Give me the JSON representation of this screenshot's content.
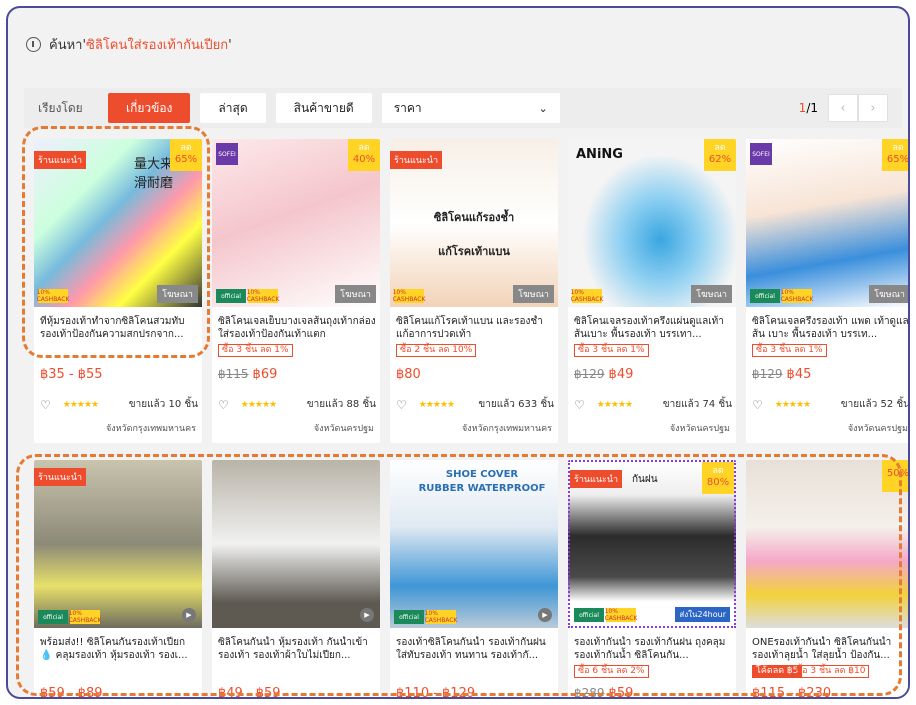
{
  "search": {
    "prefix": "ค้นหา'",
    "keyword": "ซิลิโคนใส่รองเท้ากันเปียก",
    "suffix": "'"
  },
  "sort": {
    "label": "เรียงโดย",
    "options": [
      "เกี่ยวข้อง",
      "ล่าสุด",
      "สินค้าขายดี"
    ],
    "price_label": "ราคา",
    "page": "1/1",
    "page_current": "1",
    "page_total": "/1"
  },
  "labels": {
    "recommended": "ร้านแนะนำ",
    "ad": "โฆษณา",
    "discount": "ลด",
    "official": "official",
    "cashback": "10% CASHBACK"
  },
  "row1": [
    {
      "img_text": "量大来\n防滑耐磨",
      "name": "ที่หุ้มรองเท้าทำจากซิลิโคนสวมทับรองเท้าป้องกันความสกปรกจาก...",
      "price": "฿35 - ฿55",
      "stars": "★★★★★",
      "sold": "ขายแล้ว 10 ชิ้น",
      "location": "จังหวัดกรุงเทพมหานคร",
      "discount": "65%"
    },
    {
      "img_text": "SOFEI",
      "name": "ซิลิโคนเจลเย็บบางเจลส้นถุงเท้ากล่องใส่รองเท้าป้องกันเท้าแตก",
      "promo": "ซื้อ 3 ชิ้น ลด 1%",
      "old_price": "฿115",
      "price": "฿69",
      "stars": "★★★★★",
      "sold": "ขายแล้ว 88 ชิ้น",
      "location": "จังหวัดนครปฐม",
      "discount": "40%"
    },
    {
      "img_text": "ซิลิโคนแก้รองช้ำ\nแก้โรคเท้าแบน",
      "name": "ซิลิโคนแก้โรคเท้าแบน และรองช้ำแก้อาการปวดเท้า",
      "promo": "ซื้อ 2 ชิ้น ลด 10%",
      "price": "฿80",
      "stars": "★★★★★",
      "sold": "ขายแล้ว 633 ชิ้น",
      "location": "จังหวัดกรุงเทพมหานคร"
    },
    {
      "img_text": "ANiNG",
      "name": "ซิลิโคนเจลรองเท้าครึ่งแผ่นดูแลเท้าส้นเบาะ พื้นรองเท้า บรรเทา...",
      "promo": "ซื้อ 3 ชิ้น ลด 1%",
      "old_price": "฿129",
      "price": "฿49",
      "stars": "★★★★★",
      "sold": "ขายแล้ว 74 ชิ้น",
      "location": "จังหวัดนครปฐม",
      "discount": "62%"
    },
    {
      "img_text": "SOFEI",
      "name": "ซิลิโคนเจลครึ่งรองเท้า แพด เท้าดูแล ส้น เบาะ พื้นรองเท้า บรรเท...",
      "promo": "ซื้อ 3 ชิ้น ลด 1%",
      "old_price": "฿129",
      "price": "฿45",
      "stars": "★★★★★",
      "sold": "ขายแล้ว 52 ชิ้น",
      "location": "จังหวัดนครปฐม",
      "discount": "65%"
    }
  ],
  "row2": [
    {
      "name": "พร้อมส่ง!! ซิลิโคนกันรองเท้าเปียก 💧 คลุมรองเท้า หุ้มรองเท้า รองเ...",
      "price": "฿59 - ฿89"
    },
    {
      "name": "ซิลิโคนกันน้ำ หุ้มรองเท้า กันน้ำเข้า รองเท้า รองเท้าผ้าใบไม่เปียก...",
      "price": "฿49 - ฿59"
    },
    {
      "img_text": "SHOE COVER\nRUBBER WATERPROOF",
      "name": "รองเท้าซิลิโคนกันน้ำ รองเท้ากันฝน ใส่ทับรองเท้า ทนทาน รองเท้ากั...",
      "price": "฿110 - ฿129"
    },
    {
      "img_text": "กันฝน",
      "img_text2": "ส่งใน24hour",
      "name": "รองเท้ากันน้ำ รองเท้ากันฝน ถุงคลุมรองเท้ากันน้ำ ซิลิโคนกัน...",
      "promo": "ซื้อ 6 ชิ้น ลด 2%",
      "old_price": "฿289",
      "price": "฿59",
      "discount": "80%"
    },
    {
      "name": "ONEรองเท้ากันน้ำ ซิลิโคนกันน้ำ รองเท้าลุยน้ำ ใส่ลุยน้ำ ป้องกัน...",
      "promo": "โค้ดลด ฿5",
      "promo2": "ซื้อ 3 ชิ้น ลด ฿10",
      "price": "฿115 - ฿230",
      "discount": "50%"
    }
  ],
  "colors": {
    "accent": "#ee4d2d",
    "annotation": "#e57a33",
    "frame": "#4a4a9a"
  }
}
